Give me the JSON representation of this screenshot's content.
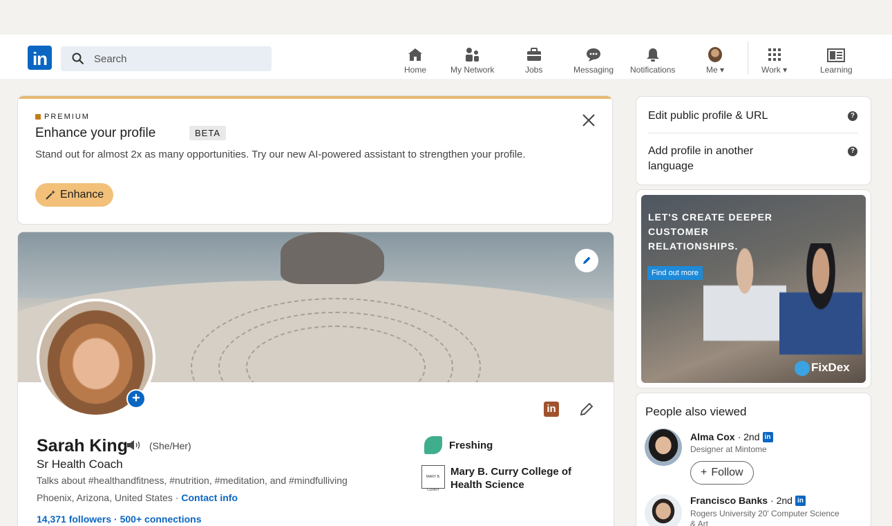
{
  "nav": {
    "search_placeholder": "Search",
    "items": [
      {
        "label": "Home",
        "icon": "home-icon"
      },
      {
        "label": "My Network",
        "icon": "network-icon"
      },
      {
        "label": "Jobs",
        "icon": "briefcase-icon"
      },
      {
        "label": "Messaging",
        "icon": "message-icon"
      },
      {
        "label": "Notifications",
        "icon": "bell-icon"
      },
      {
        "label": "Me",
        "icon": "avatar"
      },
      {
        "label": "Work",
        "icon": "grid-icon"
      },
      {
        "label": "Learning",
        "icon": "learning-icon"
      }
    ]
  },
  "premium": {
    "label": "PREMIUM",
    "title": "Enhance your profile",
    "badge": "BETA",
    "description": "Stand out for almost 2x as many opportunities. Try our new AI-powered assistant to strengthen your profile.",
    "button": "Enhance"
  },
  "profile": {
    "name": "Sarah King",
    "pronouns": "(She/Her)",
    "headline": "Sr Health Coach",
    "talks_about": "Talks about #healthandfitness, #nutrition, #meditation, and #mindfulliving",
    "location": "Phoenix, Arizona, United States",
    "separator": " · ",
    "contact": "Contact info",
    "stats": "14,371 followers · 500+ connections",
    "company": "Freshing",
    "school": "Mary B. Curry College of Health Science",
    "school_logo_text": "MARY B. CURRY"
  },
  "sidebar": {
    "edit_url": "Edit public  profile & URL",
    "add_language": "Add profile in another language",
    "help_glyph": "?"
  },
  "ad": {
    "headline": "LET'S CREATE DEEPER CUSTOMER RELATIONSHIPS.",
    "cta": "Find out more",
    "brand": "FixDex"
  },
  "people_also_viewed": {
    "title": "People also viewed",
    "people": [
      {
        "name": "Alma Cox",
        "degree": "· 2nd",
        "subtitle": "Designer at Mintome",
        "button": "Follow"
      },
      {
        "name": "Francisco Banks",
        "degree": "· 2nd",
        "subtitle": "Rogers University 20' Computer Science & Art"
      }
    ]
  },
  "colors": {
    "brand": "#0a66c2",
    "premium_gold": "#e6b871",
    "enhance_button": "#f2c079"
  }
}
